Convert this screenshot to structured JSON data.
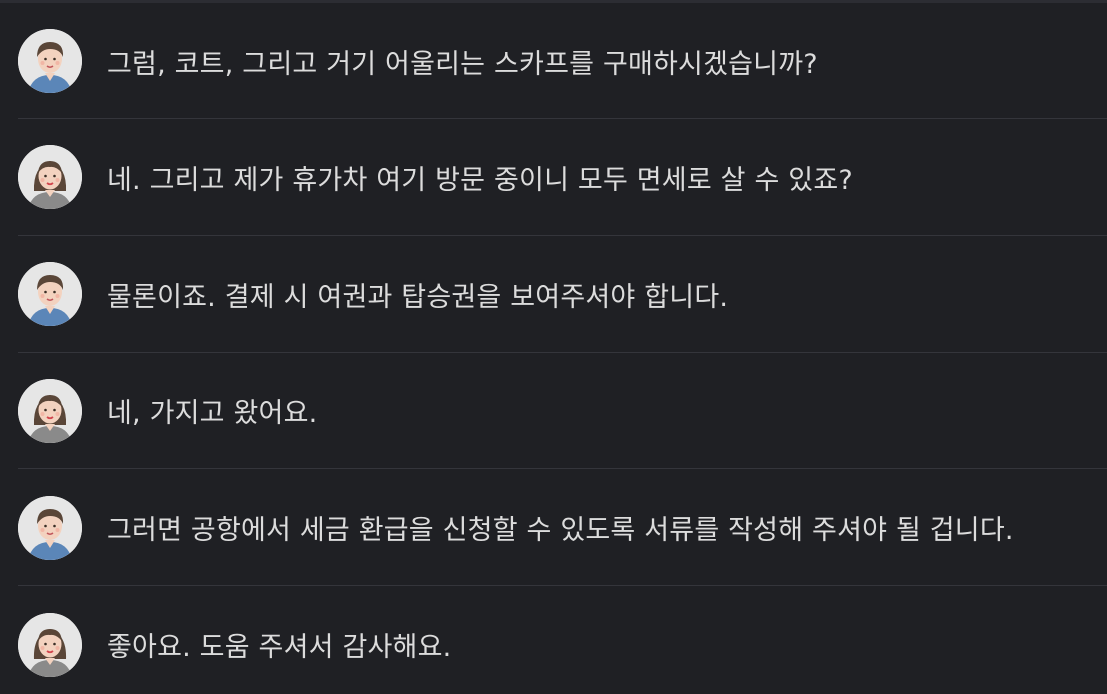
{
  "conversation": {
    "messages": [
      {
        "speaker": "male",
        "avatar_icon": "male-avatar-icon",
        "text": "그럼, 코트, 그리고 거기 어울리는 스카프를 구매하시겠습니까?"
      },
      {
        "speaker": "female",
        "avatar_icon": "female-avatar-icon",
        "text": "네. 그리고 제가 휴가차 여기 방문 중이니 모두 면세로 살 수 있죠?"
      },
      {
        "speaker": "male",
        "avatar_icon": "male-avatar-icon",
        "text": "물론이죠. 결제 시 여권과 탑승권을 보여주셔야 합니다."
      },
      {
        "speaker": "female",
        "avatar_icon": "female-avatar-icon",
        "text": "네, 가지고 왔어요."
      },
      {
        "speaker": "male",
        "avatar_icon": "male-avatar-icon",
        "text": "그러면 공항에서 세금 환급을 신청할 수 있도록 서류를 작성해 주셔야 될 겁니다."
      },
      {
        "speaker": "female",
        "avatar_icon": "female-avatar-icon",
        "text": "좋아요. 도움 주셔서 감사해요."
      }
    ]
  },
  "colors": {
    "background": "#1f2024",
    "text": "#dcdcdc",
    "divider": "#34353b",
    "male_shirt": "#5b86b8",
    "female_shirt": "#8a8a8a",
    "hair": "#5a4638",
    "skin": "#f3d2bf"
  }
}
